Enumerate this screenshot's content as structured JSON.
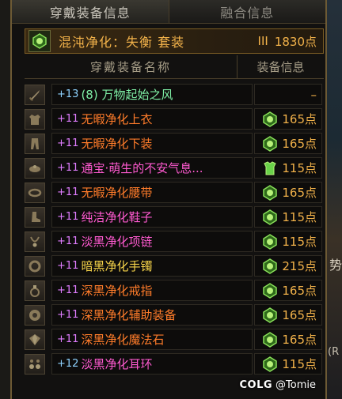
{
  "tabs": [
    {
      "label": "穿戴装备信息"
    },
    {
      "label": "融合信息"
    }
  ],
  "set_bar": {
    "name": "混沌净化：失衡  套装",
    "rank": "III",
    "points": "1830点"
  },
  "table": {
    "col_name": "穿戴装备名称",
    "col_info": "装备信息"
  },
  "equipment": [
    {
      "level": "+13",
      "name": "(8) 万物起始之风",
      "points": "–",
      "name_color": "#7ff0a6",
      "level_color": "#8fd3ff",
      "fusion": "none",
      "slot_icon": "sword-icon"
    },
    {
      "level": "+11",
      "name": "无暇净化上衣",
      "points": "165点",
      "name_color": "#ff7c2a",
      "level_color": "#e07dff",
      "fusion": "green",
      "slot_icon": "coat-icon"
    },
    {
      "level": "+11",
      "name": "无暇净化下装",
      "points": "165点",
      "name_color": "#ff7c2a",
      "level_color": "#e07dff",
      "fusion": "green",
      "slot_icon": "pants-icon"
    },
    {
      "level": "+11",
      "name": "通宝·萌生的不安气息...",
      "points": "115点",
      "name_color": "#ff5ad0",
      "level_color": "#e07dff",
      "fusion": "armor",
      "slot_icon": "shoulder-icon"
    },
    {
      "level": "+11",
      "name": "无暇净化腰带",
      "points": "165点",
      "name_color": "#ff7c2a",
      "level_color": "#e07dff",
      "fusion": "green",
      "slot_icon": "belt-icon"
    },
    {
      "level": "+11",
      "name": "纯洁净化鞋子",
      "points": "115点",
      "name_color": "#ff5ad0",
      "level_color": "#e07dff",
      "fusion": "green",
      "slot_icon": "boot-icon"
    },
    {
      "level": "+11",
      "name": "淡黑净化项链",
      "points": "115点",
      "name_color": "#ff5ad0",
      "level_color": "#e07dff",
      "fusion": "green",
      "slot_icon": "necklace-icon"
    },
    {
      "level": "+11",
      "name": "暗黑净化手镯",
      "points": "215点",
      "name_color": "#f7d54a",
      "level_color": "#e07dff",
      "fusion": "green",
      "slot_icon": "bracelet-icon"
    },
    {
      "level": "+11",
      "name": "深黑净化戒指",
      "points": "165点",
      "name_color": "#ff7c2a",
      "level_color": "#e07dff",
      "fusion": "green",
      "slot_icon": "ring-icon"
    },
    {
      "level": "+11",
      "name": "深黑净化辅助装备",
      "points": "165点",
      "name_color": "#ff7c2a",
      "level_color": "#e07dff",
      "fusion": "green",
      "slot_icon": "orb-icon"
    },
    {
      "level": "+11",
      "name": "深黑净化魔法石",
      "points": "165点",
      "name_color": "#ff7c2a",
      "level_color": "#e07dff",
      "fusion": "green",
      "slot_icon": "gem-icon"
    },
    {
      "level": "+12",
      "name": "淡黑净化耳环",
      "points": "115点",
      "name_color": "#ff5ad0",
      "level_color": "#8fd3ff",
      "fusion": "green",
      "slot_icon": "earring-icon"
    }
  ],
  "watermark": {
    "logo": "COLG",
    "handle": "@Tomie"
  },
  "side": {
    "glyph1": "势",
    "glyph2": "(R"
  },
  "colors": {
    "gold": "#f2b24a",
    "frame": "#6d5a34",
    "fusion_green": "#6ad24a"
  }
}
